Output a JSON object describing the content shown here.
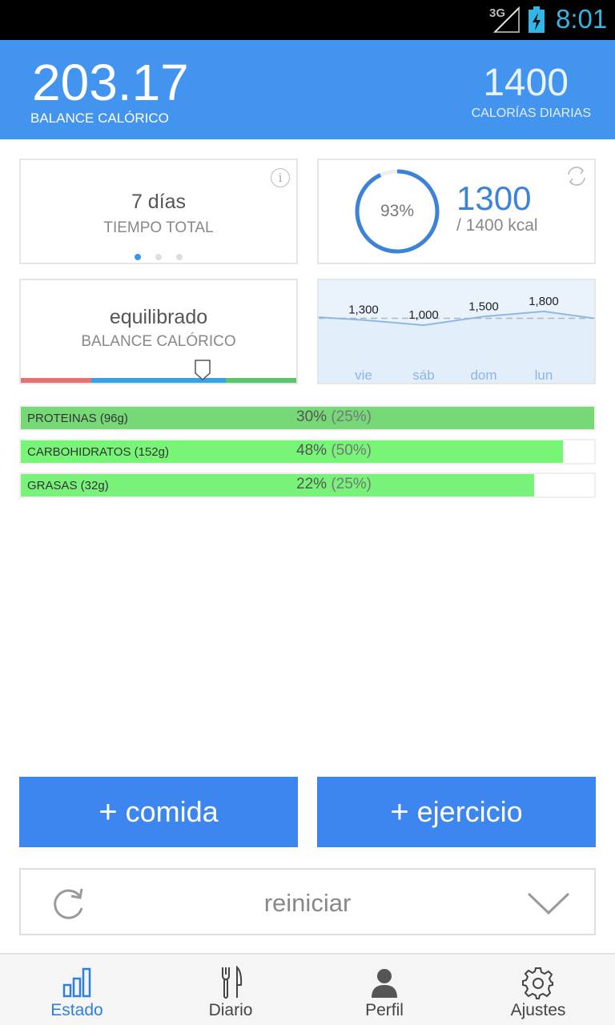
{
  "status_bar": {
    "network": "3G",
    "time": "8:01"
  },
  "header": {
    "balance_value": "203.17",
    "balance_label": "BALANCE CALÓRICO",
    "daily_value": "1400",
    "daily_label": "CALORÍAS DIARIAS"
  },
  "card_time": {
    "value": "7 días",
    "label": "TIEMPO TOTAL",
    "pages": 3,
    "active_page": 0,
    "info_icon": "info-icon"
  },
  "card_intake": {
    "percent_label": "93%",
    "percent": 0.93,
    "value": "1300",
    "sub": "/ 1400 kcal",
    "refresh_icon": "refresh-icon"
  },
  "card_balance": {
    "value": "equilibrado",
    "label": "BALANCE CALÓRICO",
    "marker_position": 0.66,
    "colors": {
      "low": "#e57373",
      "mid": "#36a2e3",
      "high": "#5cc46a"
    }
  },
  "chart_data": {
    "type": "line",
    "categories": [
      "vie",
      "sáb",
      "dom",
      "lun"
    ],
    "values": [
      1300,
      1000,
      1500,
      1800
    ],
    "value_labels": [
      "1,300",
      "1,000",
      "1,500",
      "1,800"
    ],
    "target": 1400,
    "ylim": [
      -1500,
      3600
    ],
    "grid": false
  },
  "macros": [
    {
      "name": "PROTEINAS (96g)",
      "pct": "30%",
      "goal": "(25%)",
      "fill": 1.0,
      "color": "#76d876"
    },
    {
      "name": "CARBOHIDRATOS (152g)",
      "pct": "48%",
      "goal": "(50%)",
      "fill": 0.945,
      "color": "#77f577"
    },
    {
      "name": "GRASAS (32g)",
      "pct": "22%",
      "goal": "(25%)",
      "fill": 0.895,
      "color": "#78f279"
    }
  ],
  "actions": {
    "food": "comida",
    "exercise": "ejercicio",
    "plus": "+"
  },
  "reset": {
    "label": "reiniciar"
  },
  "nav": [
    {
      "label": "Estado",
      "icon": "bar-chart-icon",
      "active": true
    },
    {
      "label": "Diario",
      "icon": "fork-knife-icon",
      "active": false
    },
    {
      "label": "Perfil",
      "icon": "person-icon",
      "active": false
    },
    {
      "label": "Ajustes",
      "icon": "gear-icon",
      "active": false
    }
  ],
  "colors": {
    "accent": "#4394ee",
    "button": "#3e86ef",
    "ring": "#3a83d8"
  }
}
